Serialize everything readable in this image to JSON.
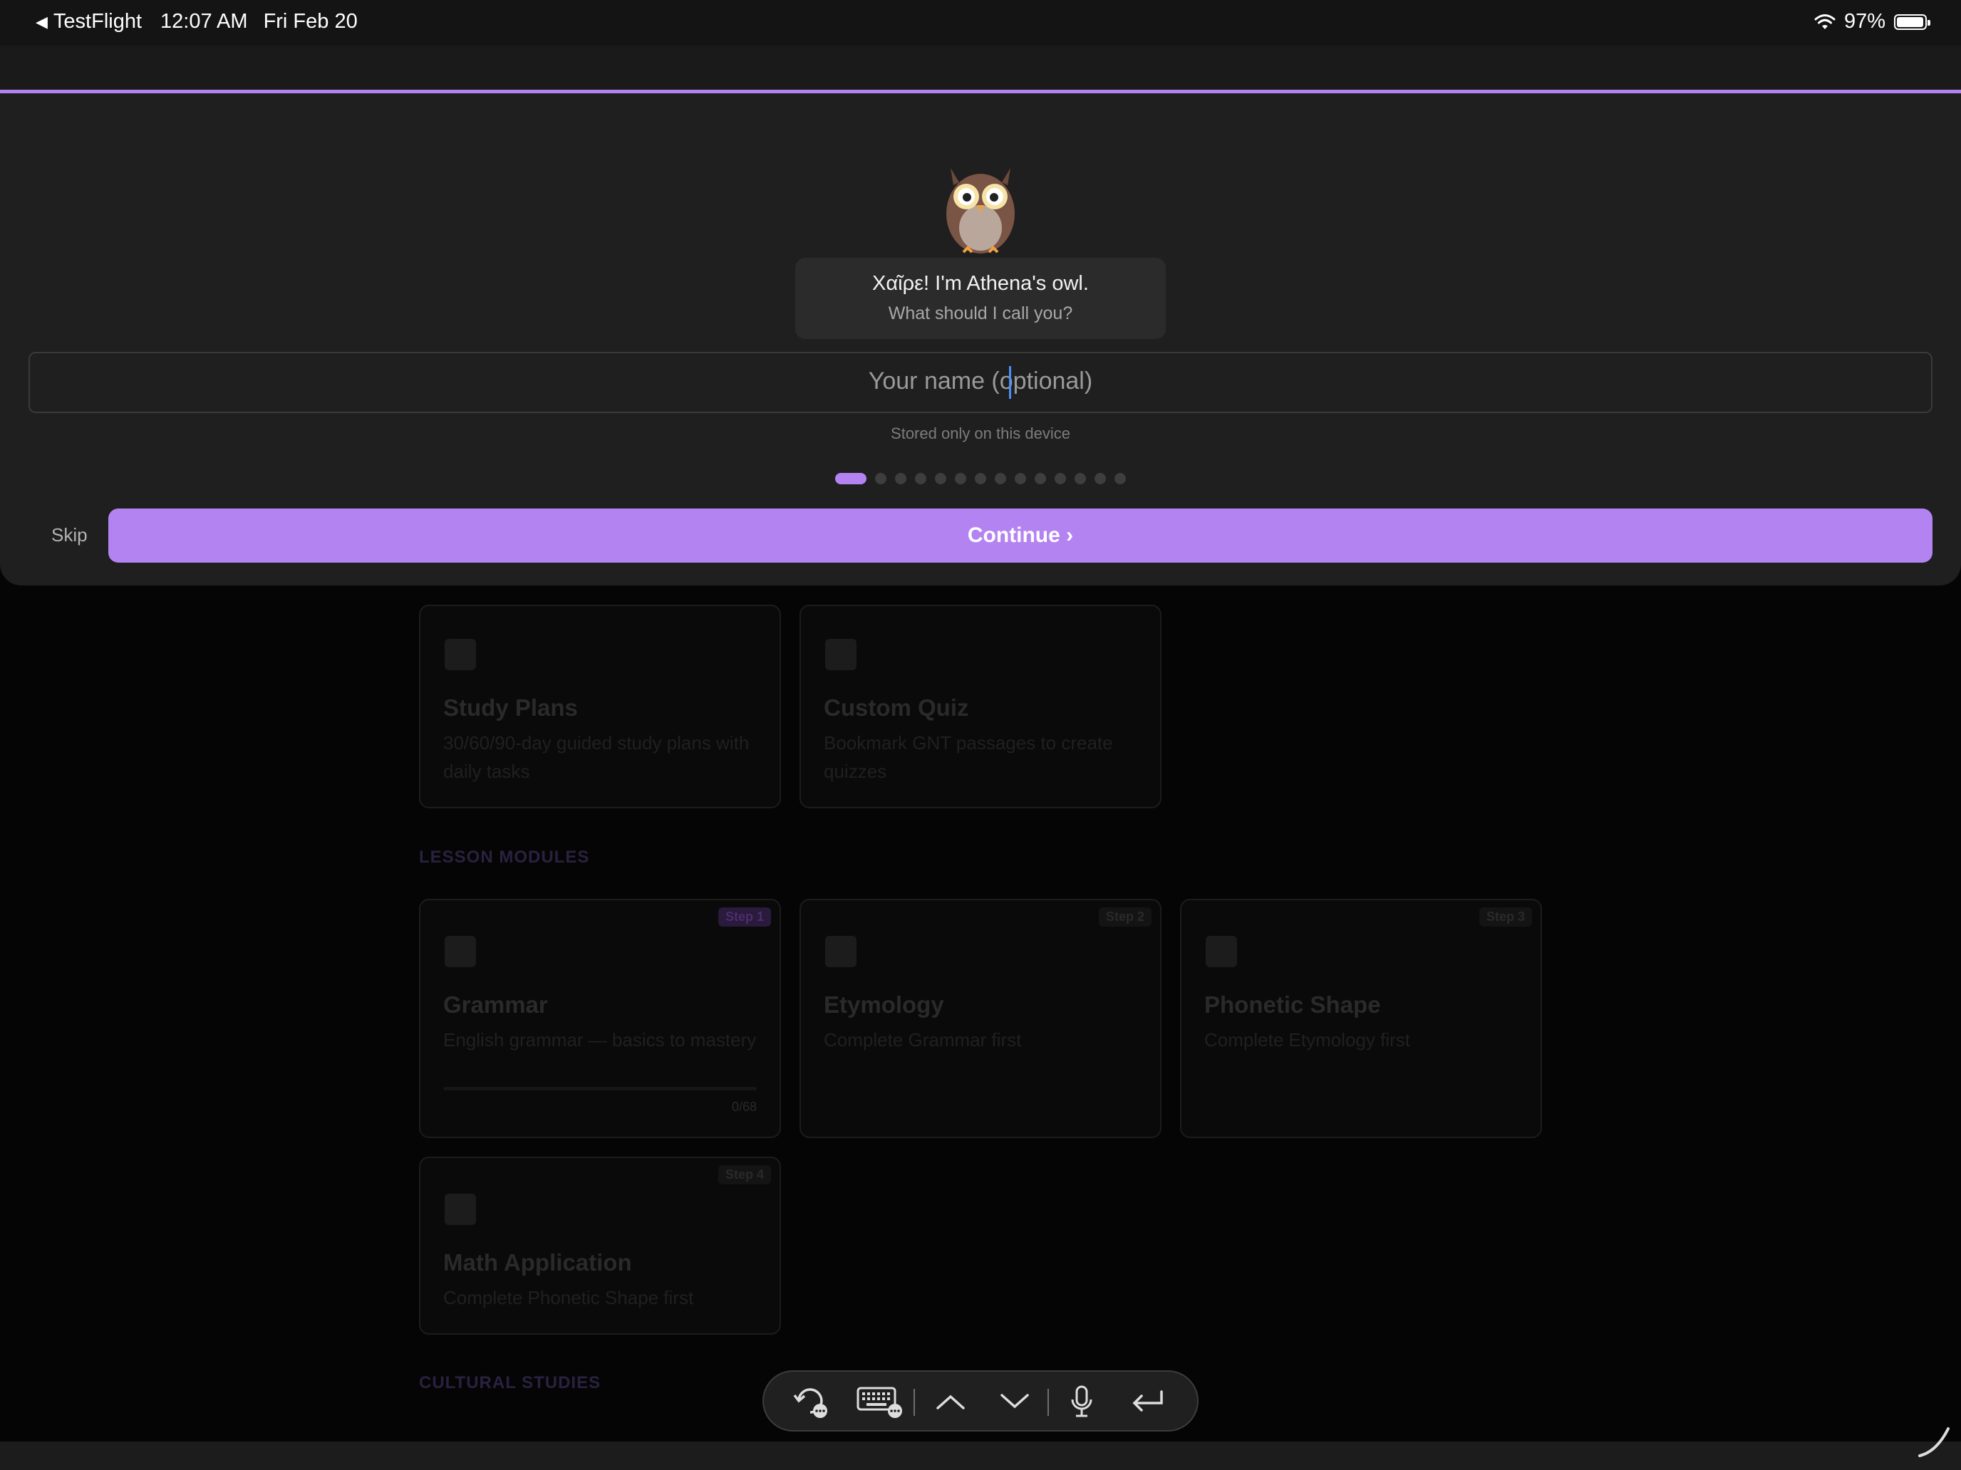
{
  "status_bar": {
    "back_app": "TestFlight",
    "time": "12:07 AM",
    "date": "Fri Feb 20",
    "battery": "97%",
    "battery_level": 0.97
  },
  "onboarding": {
    "mascot": "owl-icon",
    "greeting": "Χαῖρε! I'm Athena's owl.",
    "question": "What should I call you?",
    "name_input": {
      "placeholder": "Your name (optional)",
      "value": ""
    },
    "storage_note": "Stored only on this device",
    "pager": {
      "current": 1,
      "total": 14
    },
    "skip_label": "Skip",
    "continue_label": "Continue ›",
    "accent": "#b483f2"
  },
  "background_app": {
    "tool_cards": [
      {
        "title": "Study Plans",
        "description": "30/60/90-day guided study plans with daily tasks"
      },
      {
        "title": "Custom Quiz",
        "description": "Bookmark GNT passages to create quizzes"
      }
    ],
    "lesson_modules_heading": "LESSON MODULES",
    "modules": [
      {
        "badge": "Step 1",
        "title": "Grammar",
        "description": "English grammar — basics to mastery",
        "progress": "0/68"
      },
      {
        "badge": "Step 2",
        "title": "Etymology",
        "description": "Complete Grammar first"
      },
      {
        "badge": "Step 3",
        "title": "Phonetic Shape",
        "description": "Complete Etymology first"
      },
      {
        "badge": "Step 4",
        "title": "Math Application",
        "description": "Complete Phonetic Shape first"
      }
    ],
    "cultural_studies_heading": "CULTURAL STUDIES"
  },
  "keyboard_toolbar": {
    "buttons": [
      "undo-icon",
      "keyboard-icon",
      "chevron-up-icon",
      "chevron-down-icon",
      "microphone-icon",
      "return-icon"
    ]
  }
}
